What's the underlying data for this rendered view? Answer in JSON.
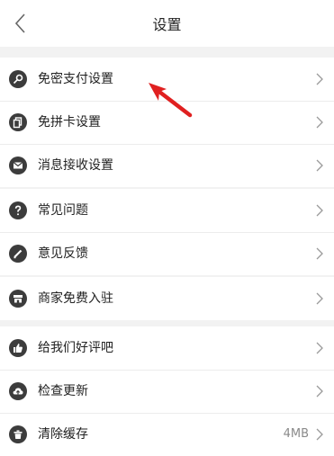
{
  "header": {
    "title": "设置",
    "back_icon": "chevron-left-icon"
  },
  "groups": [
    {
      "items": [
        {
          "label": "免密支付设置",
          "icon": "key-icon"
        },
        {
          "label": "免拼卡设置",
          "icon": "card-icon"
        },
        {
          "label": "消息接收设置",
          "icon": "envelope-icon"
        }
      ]
    },
    {
      "items": [
        {
          "label": "常见问题",
          "icon": "question-icon"
        },
        {
          "label": "意见反馈",
          "icon": "pencil-icon"
        }
      ]
    },
    {
      "items": [
        {
          "label": "商家免费入驻",
          "icon": "store-icon"
        }
      ]
    },
    {
      "items": [
        {
          "label": "给我们好评吧",
          "icon": "thumbs-up-icon"
        },
        {
          "label": "检查更新",
          "icon": "cloud-upload-icon"
        },
        {
          "label": "清除缓存",
          "icon": "trash-icon",
          "value": "4MB"
        }
      ]
    }
  ],
  "annotation": {
    "color": "#e02020",
    "icon": "red-arrow"
  },
  "colors": {
    "background": "#f2f2f2",
    "icon": "#3c3c3c",
    "annotation": "#e02020"
  }
}
